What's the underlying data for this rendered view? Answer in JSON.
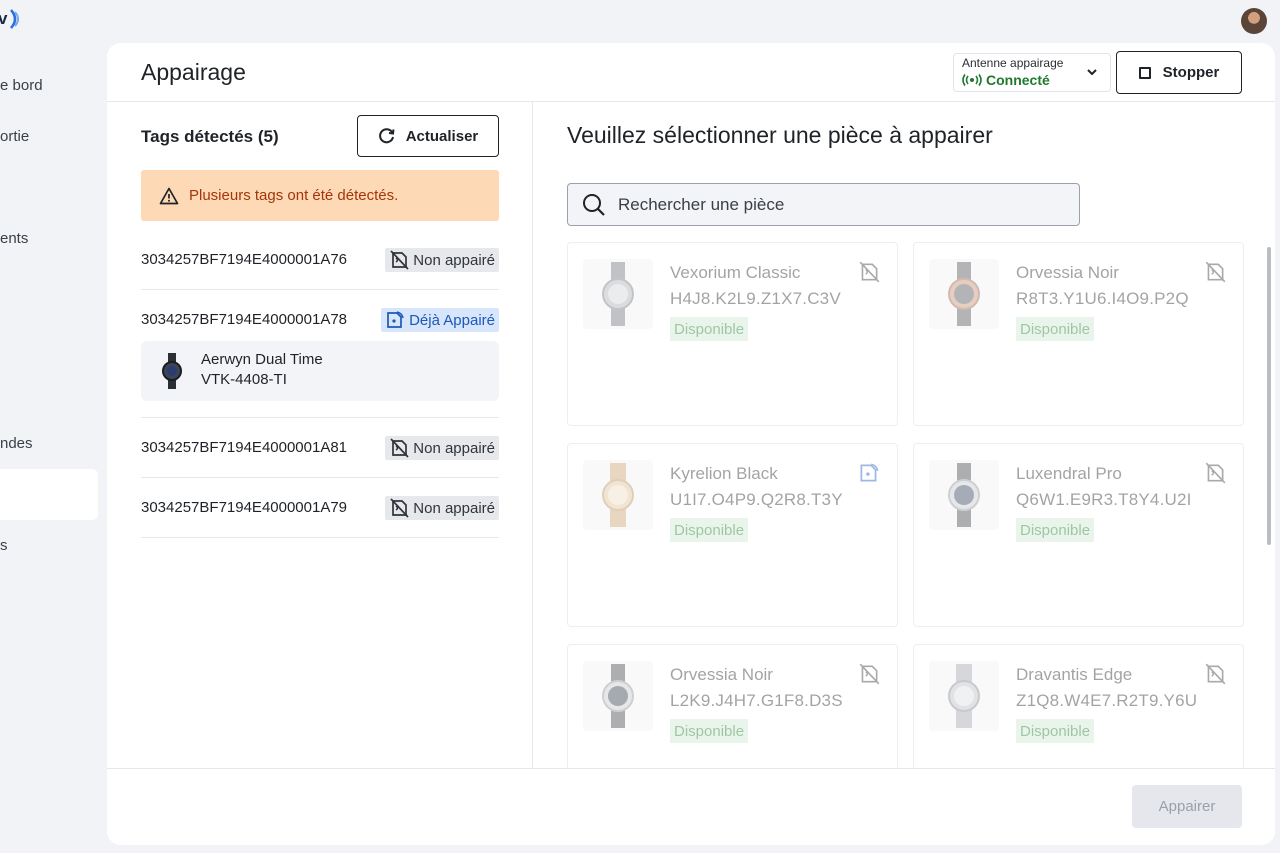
{
  "app": {
    "logo_text": "v"
  },
  "sidebar": {
    "items": [
      {
        "label": "e bord"
      },
      {
        "label": "ortie"
      },
      {
        "label": "ents"
      },
      {
        "label": "ndes"
      },
      {
        "label": "s"
      }
    ]
  },
  "header": {
    "title": "Appairage",
    "antenna": {
      "label": "Antenne appairage",
      "status": "Connecté",
      "status_color": "#1f7a2e"
    },
    "stop_label": "Stopper"
  },
  "tags": {
    "title": "Tags détectés (5)",
    "refresh_label": "Actualiser",
    "warning": "Plusieurs tags ont été détectés.",
    "rows": [
      {
        "id": "3034257BF7194E4000001A76",
        "badge": "Non appairé",
        "badge_icon": "unpaired-tag-icon"
      },
      {
        "id": "3034257BF7194E4000001A78",
        "badge": "Déjà Appairé",
        "badge_icon": "paired-tag-icon",
        "paired_item": {
          "name": "Aerwyn Dual Time",
          "ref": "VTK-4408-TI"
        }
      },
      {
        "id": "3034257BF7194E4000001A81",
        "badge": "Non appairé",
        "badge_icon": "unpaired-tag-icon"
      },
      {
        "id": "3034257BF7194E4000001A79",
        "badge": "Non appairé",
        "badge_icon": "unpaired-tag-icon"
      }
    ]
  },
  "pieces": {
    "title": "Veuillez sélectionner une pièce à appairer",
    "search_placeholder": "Rechercher une pièce",
    "items": [
      {
        "name": "Vexorium Classic",
        "ref": "H4J8.K2L9.Z1X7.C3V",
        "status": "Disponible",
        "icon": "unpaired-tag-icon"
      },
      {
        "name": "Orvessia Noir",
        "ref": "R8T3.Y1U6.I4O9.P2Q",
        "status": "Disponible",
        "icon": "unpaired-tag-icon"
      },
      {
        "name": "Kyrelion Black",
        "ref": "U1I7.O4P9.Q2R8.T3Y",
        "status": "Disponible",
        "icon": "paired-tag-icon"
      },
      {
        "name": "Luxendral Pro",
        "ref": "Q6W1.E9R3.T8Y4.U2I",
        "status": "Disponible",
        "icon": "unpaired-tag-icon"
      },
      {
        "name": "Orvessia Noir",
        "ref": "L2K9.J4H7.G1F8.D3S",
        "status": "Disponible",
        "icon": "unpaired-tag-icon"
      },
      {
        "name": "Dravantis Edge",
        "ref": "Z1Q8.W4E7.R2T9.Y6U",
        "status": "Disponible",
        "icon": "unpaired-tag-icon"
      }
    ]
  },
  "footer": {
    "pair_label": "Appairer"
  }
}
